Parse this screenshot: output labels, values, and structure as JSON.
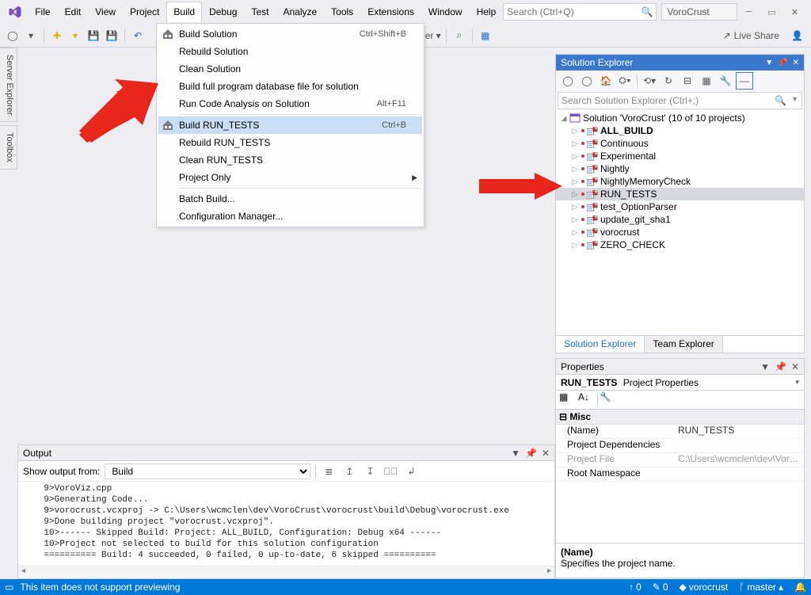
{
  "menu": {
    "items": [
      "File",
      "Edit",
      "View",
      "Project",
      "Build",
      "Debug",
      "Test",
      "Analyze",
      "Tools",
      "Extensions",
      "Window",
      "Help"
    ],
    "open": "Build"
  },
  "search": {
    "placeholder": "Search (Ctrl+Q)"
  },
  "solution_name": "VoroCrust",
  "live_share": "Live Share",
  "build_menu": [
    {
      "label": "Build Solution",
      "shortcut": "Ctrl+Shift+B",
      "icon": "build"
    },
    {
      "label": "Rebuild Solution"
    },
    {
      "label": "Clean Solution"
    },
    {
      "label": "Build full program database file for solution"
    },
    {
      "label": "Run Code Analysis on Solution",
      "shortcut": "Alt+F11"
    },
    {
      "sep": true
    },
    {
      "label": "Build RUN_TESTS",
      "shortcut": "Ctrl+B",
      "icon": "build",
      "hl": true
    },
    {
      "label": "Rebuild RUN_TESTS"
    },
    {
      "label": "Clean RUN_TESTS"
    },
    {
      "label": "Project Only",
      "sub": true
    },
    {
      "sep": true
    },
    {
      "label": "Batch Build..."
    },
    {
      "label": "Configuration Manager..."
    }
  ],
  "left_tabs": [
    "Server Explorer",
    "Toolbox"
  ],
  "output": {
    "title": "Output",
    "from_label": "Show output from:",
    "from_value": "Build",
    "lines": [
      "    9>VoroViz.cpp",
      "    9>Generating Code...",
      "    9>vorocrust.vcxproj -> C:\\Users\\wcmclen\\dev\\VoroCrust\\vorocrust\\build\\Debug\\vorocrust.exe",
      "    9>Done building project \"vorocrust.vcxproj\".",
      "    10>------ Skipped Build: Project: ALL_BUILD, Configuration: Debug x64 ------",
      "    10>Project not selected to build for this solution configuration",
      "    ========== Build: 4 succeeded, 0 failed, 0 up-to-date, 6 skipped =========="
    ]
  },
  "solution_explorer": {
    "title": "Solution Explorer",
    "search_placeholder": "Search Solution Explorer (Ctrl+;)",
    "root": "Solution 'VoroCrust' (10 of 10 projects)",
    "projects": [
      "ALL_BUILD",
      "Continuous",
      "Experimental",
      "Nightly",
      "NightlyMemoryCheck",
      "RUN_TESTS",
      "test_OptionParser",
      "update_git_sha1",
      "vorocrust",
      "ZERO_CHECK"
    ],
    "selected": "RUN_TESTS",
    "tabs": [
      "Solution Explorer",
      "Team Explorer"
    ]
  },
  "properties": {
    "title": "Properties",
    "object_bold": "RUN_TESTS",
    "object_type": "Project Properties",
    "cat": "Misc",
    "rows": [
      {
        "k": "(Name)",
        "v": "RUN_TESTS"
      },
      {
        "k": "Project Dependencies",
        "v": ""
      },
      {
        "k": "Project File",
        "v": "C:\\Users\\wcmclen\\dev\\VoroCrust\\vc",
        "dim": true
      },
      {
        "k": "Root Namespace",
        "v": ""
      }
    ],
    "help_name": "(Name)",
    "help_desc": "Specifies the project name."
  },
  "status": {
    "msg": "This item does not support previewing",
    "up": "0",
    "down": "0",
    "repo": "vorocrust",
    "branch": "master"
  }
}
